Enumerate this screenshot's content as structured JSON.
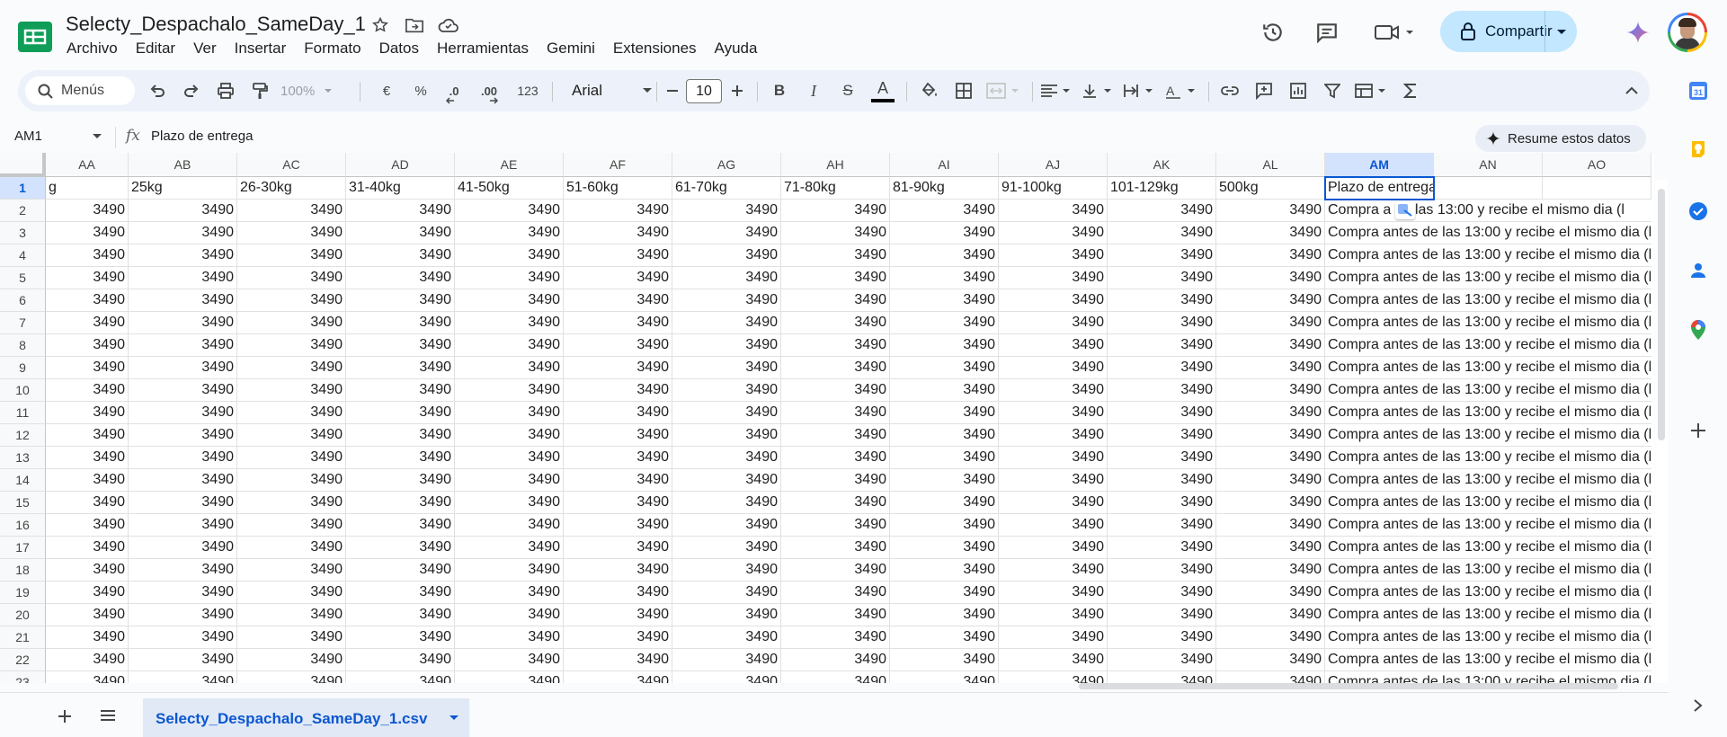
{
  "doc": {
    "title": "Selecty_Despachalo_SameDay_1",
    "menu": [
      "Archivo",
      "Editar",
      "Ver",
      "Insertar",
      "Formato",
      "Datos",
      "Herramientas",
      "Gemini",
      "Extensiones",
      "Ayuda"
    ],
    "share_label": "Compartir"
  },
  "toolbar": {
    "search_label": "Menús",
    "zoom": "100%",
    "currency": "€",
    "percent": "%",
    "dec_decrease": ".0",
    "dec_increase": ".00",
    "number_format": "123",
    "font": "Arial",
    "font_size": "10",
    "bold": "B",
    "italic": "I",
    "strike": "S",
    "text_color": "A"
  },
  "formula_bar": {
    "name_box": "AM1",
    "fx": "fx",
    "content": "Plazo de entrega",
    "summarize_label": "Resume estos datos"
  },
  "grid": {
    "columns": [
      "AA",
      "AB",
      "AC",
      "AD",
      "AE",
      "AF",
      "AG",
      "AH",
      "AI",
      "AJ",
      "AK",
      "AL",
      "AM",
      "AN",
      "AO"
    ],
    "selected_column": "AM",
    "selected_row": "1",
    "header_row": [
      "g",
      "25kg",
      "26-30kg",
      "31-40kg",
      "41-50kg",
      "51-60kg",
      "61-70kg",
      "71-80kg",
      "81-90kg",
      "91-100kg",
      "101-129kg",
      "500kg",
      "Plazo de entrega",
      "",
      ""
    ],
    "rows": [
      "2",
      "3",
      "4",
      "5",
      "6",
      "7",
      "8",
      "9",
      "10",
      "11",
      "12",
      "13",
      "14",
      "15",
      "16",
      "17",
      "18",
      "19",
      "20",
      "21",
      "22",
      "23"
    ],
    "price_value": "3490",
    "delivery_text": "Compra antes de las 13:00 y recibe el mismo dia (l",
    "row2_delivery_text": "Compra a   de las 13:00 y recibe el mismo dia (l"
  },
  "sheets": {
    "active_tab": "Selecty_Despachalo_SameDay_1.csv"
  },
  "colors": {
    "accent": "#0b57d0",
    "share_bg": "#c2e7ff",
    "toolbar_bg": "#edf2fa",
    "sheets_green": "#0f9d58"
  }
}
